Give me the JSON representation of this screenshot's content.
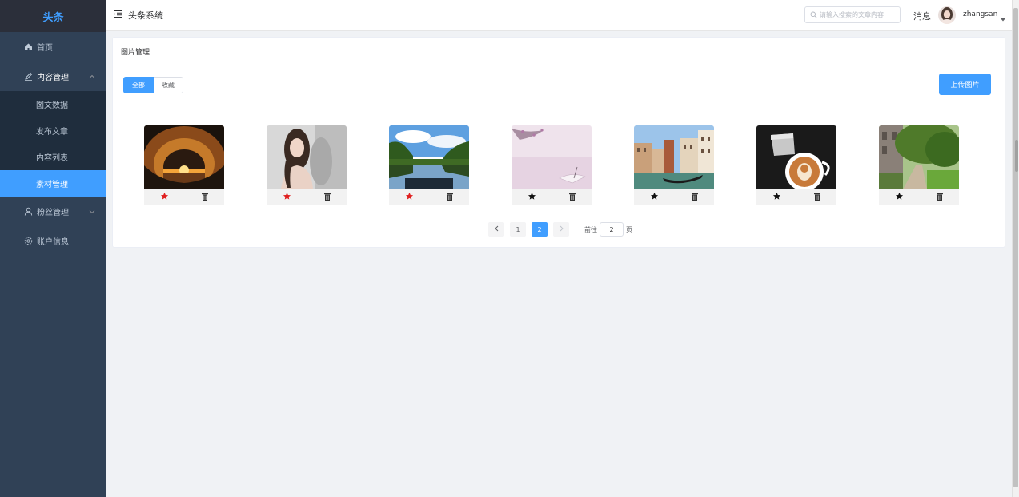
{
  "sidebar": {
    "logo": "头条",
    "items": [
      {
        "label": "首页",
        "icon": "home-icon"
      },
      {
        "label": "内容管理",
        "icon": "edit-icon",
        "open": true,
        "children": [
          {
            "label": "图文数据"
          },
          {
            "label": "发布文章"
          },
          {
            "label": "内容列表"
          },
          {
            "label": "素材管理",
            "active": true
          }
        ]
      },
      {
        "label": "粉丝管理",
        "icon": "user-icon"
      },
      {
        "label": "账户信息",
        "icon": "settings-icon"
      }
    ]
  },
  "header": {
    "title": "头条系统",
    "search_placeholder": "请输入搜索的文章内容",
    "messages": "消息",
    "username": "zhangsan"
  },
  "main": {
    "card_title": "图片管理",
    "tabs": [
      {
        "label": "全部",
        "active": true
      },
      {
        "label": "收藏"
      }
    ],
    "upload_label": "上传图片",
    "images": [
      {
        "scene": "wave-sunset",
        "favorite": true
      },
      {
        "scene": "portrait",
        "favorite": true
      },
      {
        "scene": "lake-forest",
        "favorite": true
      },
      {
        "scene": "umbrella-blossom",
        "favorite": false
      },
      {
        "scene": "venice-canal",
        "favorite": false
      },
      {
        "scene": "latte-art",
        "favorite": false
      },
      {
        "scene": "garden-path",
        "favorite": false
      }
    ],
    "pagination": {
      "pages": [
        "1",
        "2"
      ],
      "current_page": "2",
      "goto_prefix": "前往",
      "goto_value": "2",
      "goto_suffix": "页"
    }
  },
  "colors": {
    "accent": "#409eff",
    "sidebar_bg": "#304156",
    "favorite_on": "#e02020",
    "favorite_off": "#111111"
  }
}
